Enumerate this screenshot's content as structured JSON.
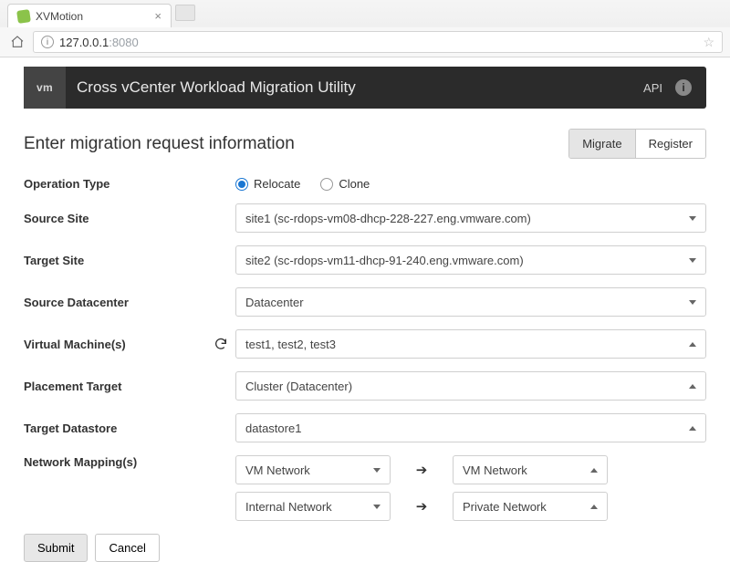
{
  "browser": {
    "tab_title": "XVMotion",
    "url_host": "127.0.0.1",
    "url_port": ":8080"
  },
  "appHeader": {
    "logo_text": "vm",
    "title": "Cross vCenter Workload Migration Utility",
    "api_link": "API"
  },
  "heading": "Enter migration request information",
  "modeButtons": {
    "migrate": "Migrate",
    "register": "Register"
  },
  "labels": {
    "operation_type": "Operation Type",
    "source_site": "Source Site",
    "target_site": "Target Site",
    "source_datacenter": "Source Datacenter",
    "virtual_machines": "Virtual Machine(s)",
    "placement_target": "Placement Target",
    "target_datastore": "Target Datastore",
    "network_mappings": "Network Mapping(s)"
  },
  "operation": {
    "relocate": "Relocate",
    "clone": "Clone",
    "selected": "relocate"
  },
  "fields": {
    "source_site": "site1 (sc-rdops-vm08-dhcp-228-227.eng.vmware.com)",
    "target_site": "site2 (sc-rdops-vm11-dhcp-91-240.eng.vmware.com)",
    "source_datacenter": "Datacenter",
    "virtual_machines": "test1, test2, test3",
    "placement_target": "Cluster (Datacenter)",
    "target_datastore": "datastore1"
  },
  "networkMappings": [
    {
      "src": "VM Network",
      "dst": "VM Network"
    },
    {
      "src": "Internal Network",
      "dst": "Private Network"
    }
  ],
  "actions": {
    "submit": "Submit",
    "cancel": "Cancel"
  }
}
